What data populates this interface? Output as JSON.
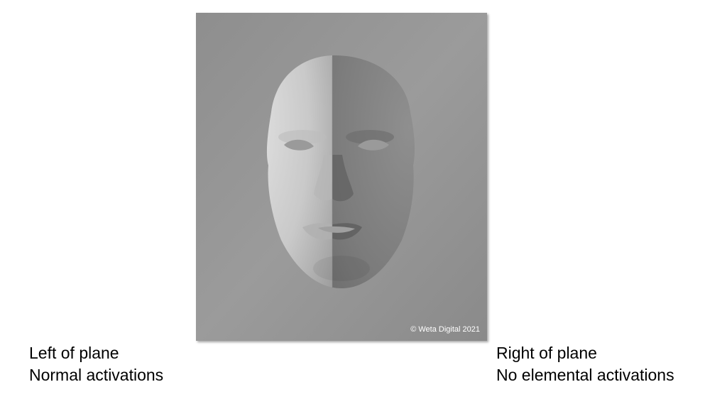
{
  "image": {
    "copyright": "© Weta Digital 2021",
    "subject": "face-mesh-render"
  },
  "captions": {
    "left": {
      "line1": "Left of plane",
      "line2": "Normal activations"
    },
    "right": {
      "line1": "Right of plane",
      "line2": "No elemental activations"
    }
  }
}
